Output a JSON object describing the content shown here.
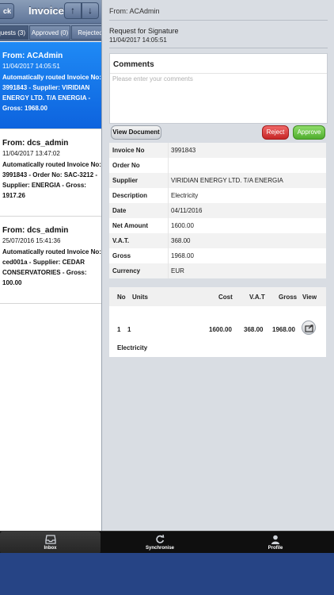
{
  "nav": {
    "back_label": "ck",
    "title": "Invoice",
    "up_arrow": "↑",
    "down_arrow": "↓"
  },
  "segments": {
    "requests": "quests (3)",
    "approved": "Approved (0)",
    "rejected": "Rejected"
  },
  "list": [
    {
      "from": "From: ACAdmin",
      "date": "11/04/2017 14:05:51",
      "desc": "Automatically routed Invoice No: 3991843 - Supplier: VIRIDIAN ENERGY LTD. T/A ENERGIA - Gross: 1968.00",
      "selected": true
    },
    {
      "from": "From: dcs_admin",
      "date": "11/04/2017 13:47:02",
      "desc": "Automatically routed Invoice No: 3991843 - Order No: SAC-3212 - Supplier: ENERGIA - Gross: 1917.26",
      "selected": false
    },
    {
      "from": "From: dcs_admin",
      "date": "25/07/2016 15:41:36",
      "desc": "Automatically routed Invoice No: ced001a - Supplier: CEDAR CONSERVATORIES - Gross: 100.00",
      "selected": false
    }
  ],
  "detail": {
    "from": "From: ACAdmin",
    "request_title": "Request for Signature",
    "request_date": "11/04/2017 14:05:51",
    "comments_title": "Comments",
    "comments_placeholder": "Please enter your comments",
    "comments_value": "",
    "view_document": "View Document",
    "reject": "Reject",
    "approve": "Approve",
    "fields": [
      {
        "label": "Invoice No",
        "value": "3991843"
      },
      {
        "label": "Order No",
        "value": ""
      },
      {
        "label": "Supplier",
        "value": "VIRIDIAN ENERGY LTD. T/A ENERGIA"
      },
      {
        "label": "Description",
        "value": "Electricity"
      },
      {
        "label": "Date",
        "value": "04/11/2016"
      },
      {
        "label": "Net Amount",
        "value": "1600.00"
      },
      {
        "label": "V.A.T.",
        "value": "368.00"
      },
      {
        "label": "Gross",
        "value": "1968.00"
      },
      {
        "label": "Currency",
        "value": "EUR"
      }
    ],
    "lines_header": {
      "no": "No",
      "units": "Units",
      "cost": "Cost",
      "vat": "V.A.T",
      "gross": "Gross",
      "view": "View"
    },
    "lines": [
      {
        "no": "1",
        "units": "1",
        "cost": "1600.00",
        "vat": "368.00",
        "gross": "1968.00",
        "description": "Electricity"
      }
    ]
  },
  "tabs": {
    "inbox": "Inbox",
    "synchronise": "Synchronise",
    "profile": "Profile"
  },
  "colors": {
    "selected_item": "#1a7ff0",
    "reject": "#d43a3a",
    "approve": "#6cc64a",
    "nav_bar": "#6f84a6",
    "bottom_band": "#264485"
  },
  "icons": {
    "inbox": "inbox-tray-icon",
    "synchronise": "refresh-icon",
    "profile": "person-icon",
    "line_view": "open-document-icon"
  }
}
